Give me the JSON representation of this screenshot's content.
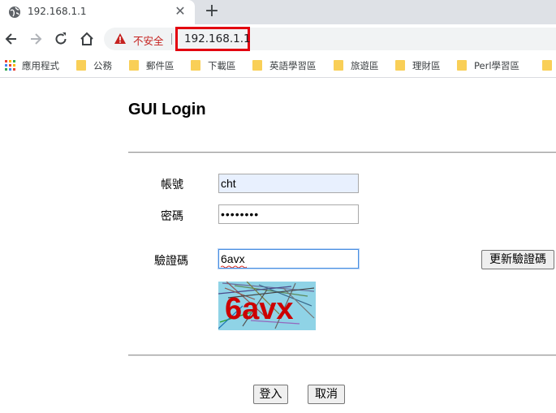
{
  "browser": {
    "tab": {
      "title": "192.168.1.1",
      "favicon": "globe-icon"
    },
    "omnibox": {
      "security_label": "不安全",
      "url": "192.168.1.1",
      "highlight_color": "#e3000f"
    },
    "bookmarks": [
      {
        "label": "應用程式",
        "icon": "apps-grid-icon"
      },
      {
        "label": "公務",
        "icon": "folder-icon"
      },
      {
        "label": "郵件區",
        "icon": "folder-icon"
      },
      {
        "label": "下載區",
        "icon": "folder-icon"
      },
      {
        "label": "英語學習區",
        "icon": "folder-icon"
      },
      {
        "label": "旅遊區",
        "icon": "folder-icon"
      },
      {
        "label": "理財區",
        "icon": "folder-icon"
      },
      {
        "label": "Perl學習區",
        "icon": "folder-icon"
      }
    ]
  },
  "login": {
    "title": "GUI Login",
    "account": {
      "label": "帳號",
      "value": "cht"
    },
    "password": {
      "label": "密碼",
      "masked_value": "••••••••"
    },
    "captcha": {
      "label": "驗證碼",
      "value": "6avx",
      "refresh_label": "更新驗證碼",
      "image_text": "6avx",
      "image_text_color": "#cc0000",
      "image_bg_color": "#8fd3e6"
    },
    "submit_label": "登入",
    "cancel_label": "取消"
  }
}
